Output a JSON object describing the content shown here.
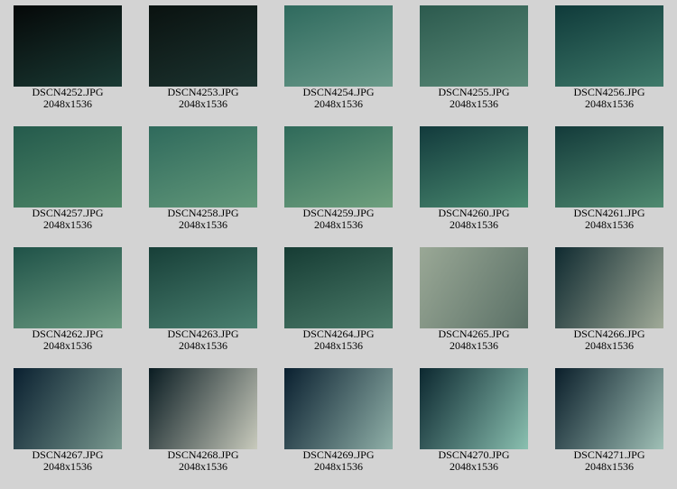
{
  "images": [
    {
      "name": "DSCN4252.JPG",
      "size": "2048x1536",
      "c1": "#050808",
      "c2": "#1a3a34"
    },
    {
      "name": "DSCN4253.JPG",
      "size": "2048x1536",
      "c1": "#0a1210",
      "c2": "#1c3430"
    },
    {
      "name": "DSCN4254.JPG",
      "size": "2048x1536",
      "c1": "#2f6a5e",
      "c2": "#6a9a8a"
    },
    {
      "name": "DSCN4255.JPG",
      "size": "2048x1536",
      "c1": "#2c5a4e",
      "c2": "#5a8a78"
    },
    {
      "name": "DSCN4256.JPG",
      "size": "2048x1536",
      "c1": "#0f3a3a",
      "c2": "#3f7a6a"
    },
    {
      "name": "DSCN4257.JPG",
      "size": "2048x1536",
      "c1": "#245a4c",
      "c2": "#4f8868"
    },
    {
      "name": "DSCN4258.JPG",
      "size": "2048x1536",
      "c1": "#2f6a5c",
      "c2": "#62987a"
    },
    {
      "name": "DSCN4259.JPG",
      "size": "2048x1536",
      "c1": "#2f6a5a",
      "c2": "#6fa07e"
    },
    {
      "name": "DSCN4260.JPG",
      "size": "2048x1536",
      "c1": "#123a3c",
      "c2": "#4a8a70"
    },
    {
      "name": "DSCN4261.JPG",
      "size": "2048x1536",
      "c1": "#133a3a",
      "c2": "#4f8a70"
    },
    {
      "name": "DSCN4262.JPG",
      "size": "2048x1536",
      "c1": "#1f5248",
      "c2": "#6a9a80"
    },
    {
      "name": "DSCN4263.JPG",
      "size": "2048x1536",
      "c1": "#173f38",
      "c2": "#4a8070"
    },
    {
      "name": "DSCN4264.JPG",
      "size": "2048x1536",
      "c1": "#163c34",
      "c2": "#4a7a68"
    },
    {
      "name": "DSCN4265.JPG",
      "size": "2048x1536",
      "c1": "#9aa896",
      "c2": "#5a7066"
    },
    {
      "name": "DSCN4266.JPG",
      "size": "2048x1536",
      "c1": "#0f2a30",
      "c2": "#a0aa98"
    },
    {
      "name": "DSCN4267.JPG",
      "size": "2048x1536",
      "c1": "#0a2030",
      "c2": "#7a9a90"
    },
    {
      "name": "DSCN4268.JPG",
      "size": "2048x1536",
      "c1": "#0a1c22",
      "c2": "#c8cabc"
    },
    {
      "name": "DSCN4269.JPG",
      "size": "2048x1536",
      "c1": "#0a2030",
      "c2": "#90b0a8"
    },
    {
      "name": "DSCN4270.JPG",
      "size": "2048x1536",
      "c1": "#0c2830",
      "c2": "#8ac0b0"
    },
    {
      "name": "DSCN4271.JPG",
      "size": "2048x1536",
      "c1": "#0a1e2a",
      "c2": "#a0c0b6"
    }
  ]
}
